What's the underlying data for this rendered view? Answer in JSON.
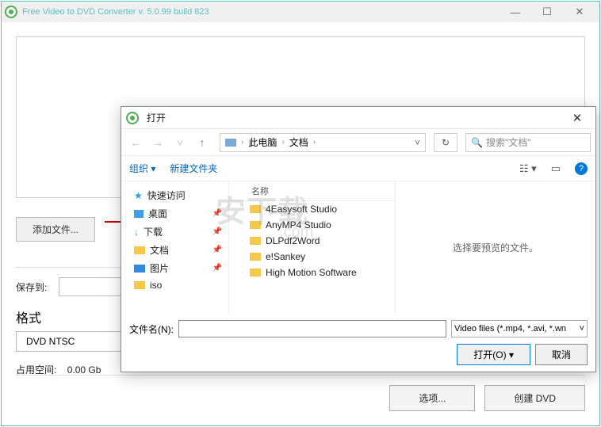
{
  "app": {
    "title": "Free Video to DVD Converter  v. 5.0.99 build 823",
    "add_file": "添加文件...",
    "save_to_label": "保存到:",
    "format_label": "格式",
    "format_value": "DVD NTSC",
    "space_label": "占用空间:",
    "space_value": "0.00 Gb",
    "options_btn": "选项...",
    "create_btn": "创建 DVD"
  },
  "dialog": {
    "title": "打开",
    "crumb": {
      "root_icon": "pc",
      "parts": [
        "此电脑",
        "文档"
      ]
    },
    "search_placeholder": "搜索\"文档\"",
    "toolbar": {
      "organize": "组织",
      "new_folder": "新建文件夹"
    },
    "sidebar": [
      {
        "icon": "quick",
        "label": "快速访问"
      },
      {
        "icon": "desktop",
        "label": "桌面",
        "pinned": true
      },
      {
        "icon": "download",
        "label": "下载",
        "pinned": true
      },
      {
        "icon": "docs",
        "label": "文档",
        "pinned": true
      },
      {
        "icon": "pictures",
        "label": "图片",
        "pinned": true
      },
      {
        "icon": "folder",
        "label": "iso"
      }
    ],
    "list_header": "名称",
    "folders": [
      "4Easysoft Studio",
      "AnyMP4 Studio",
      "DLPdf2Word",
      "e!Sankey",
      "High Motion Software"
    ],
    "preview_msg": "选择要预览的文件。",
    "filename_label": "文件名(N):",
    "filter": "Video files (*.mp4, *.avi, *.wn",
    "open_btn": "打开(O)",
    "cancel_btn": "取消"
  }
}
